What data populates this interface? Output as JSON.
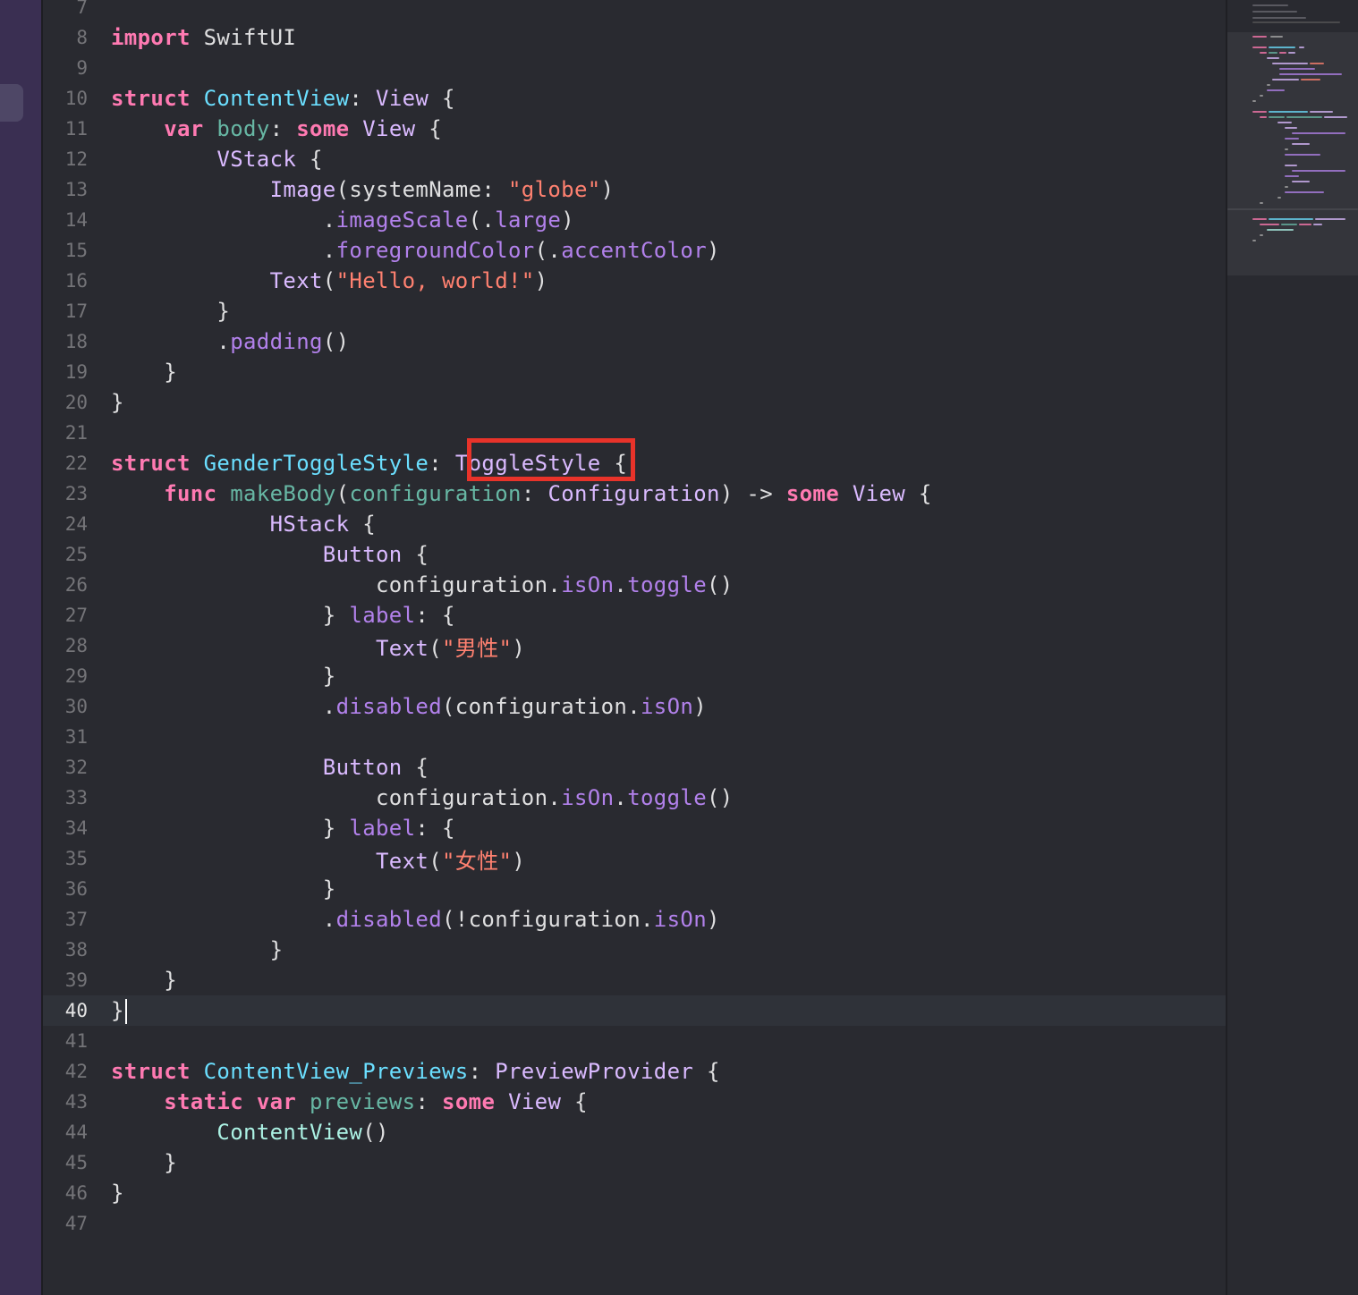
{
  "editor": {
    "language": "Swift",
    "current_line": 40,
    "highlight_color": "#e8332a",
    "highlighted_token": "ToggleStyle",
    "lines": [
      {
        "n": "7",
        "tokens": []
      },
      {
        "n": "8",
        "tokens": [
          [
            "kw",
            "import"
          ],
          [
            "p",
            " SwiftUI"
          ]
        ]
      },
      {
        "n": "9",
        "tokens": []
      },
      {
        "n": "10",
        "tokens": [
          [
            "kw",
            "struct"
          ],
          [
            "p",
            " "
          ],
          [
            "decl",
            "ContentView"
          ],
          [
            "p",
            ": "
          ],
          [
            "typ",
            "View"
          ],
          [
            "p",
            " {"
          ]
        ]
      },
      {
        "n": "11",
        "tokens": [
          [
            "p",
            "    "
          ],
          [
            "kw",
            "var"
          ],
          [
            "p",
            " "
          ],
          [
            "dfn",
            "body"
          ],
          [
            "p",
            ": "
          ],
          [
            "kw",
            "some"
          ],
          [
            "p",
            " "
          ],
          [
            "typ",
            "View"
          ],
          [
            "p",
            " {"
          ]
        ]
      },
      {
        "n": "12",
        "tokens": [
          [
            "p",
            "        "
          ],
          [
            "typ",
            "VStack"
          ],
          [
            "p",
            " {"
          ]
        ]
      },
      {
        "n": "13",
        "tokens": [
          [
            "p",
            "            "
          ],
          [
            "typ",
            "Image"
          ],
          [
            "p",
            "(systemName: "
          ],
          [
            "str",
            "\"globe\""
          ],
          [
            "p",
            ")"
          ]
        ]
      },
      {
        "n": "14",
        "tokens": [
          [
            "p",
            "                ."
          ],
          [
            "prop",
            "imageScale"
          ],
          [
            "p",
            "(."
          ],
          [
            "prop",
            "large"
          ],
          [
            "p",
            ")"
          ]
        ]
      },
      {
        "n": "15",
        "tokens": [
          [
            "p",
            "                ."
          ],
          [
            "prop",
            "foregroundColor"
          ],
          [
            "p",
            "(."
          ],
          [
            "prop",
            "accentColor"
          ],
          [
            "p",
            ")"
          ]
        ]
      },
      {
        "n": "16",
        "tokens": [
          [
            "p",
            "            "
          ],
          [
            "typ",
            "Text"
          ],
          [
            "p",
            "("
          ],
          [
            "str",
            "\"Hello, world!\""
          ],
          [
            "p",
            ")"
          ]
        ]
      },
      {
        "n": "17",
        "tokens": [
          [
            "p",
            "        }"
          ]
        ]
      },
      {
        "n": "18",
        "tokens": [
          [
            "p",
            "        ."
          ],
          [
            "prop",
            "padding"
          ],
          [
            "p",
            "()"
          ]
        ]
      },
      {
        "n": "19",
        "tokens": [
          [
            "p",
            "    }"
          ]
        ]
      },
      {
        "n": "20",
        "tokens": [
          [
            "p",
            "}"
          ]
        ]
      },
      {
        "n": "21",
        "tokens": []
      },
      {
        "n": "22",
        "tokens": [
          [
            "kw",
            "struct"
          ],
          [
            "p",
            " "
          ],
          [
            "decl",
            "GenderToggleStyle"
          ],
          [
            "p",
            ": "
          ],
          [
            "typ",
            "ToggleStyle"
          ],
          [
            "p",
            " {"
          ]
        ]
      },
      {
        "n": "23",
        "tokens": [
          [
            "p",
            "    "
          ],
          [
            "kw",
            "func"
          ],
          [
            "p",
            " "
          ],
          [
            "dfn",
            "makeBody"
          ],
          [
            "p",
            "("
          ],
          [
            "dfn",
            "configuration"
          ],
          [
            "p",
            ": "
          ],
          [
            "typ",
            "Configuration"
          ],
          [
            "p",
            ") -> "
          ],
          [
            "kw",
            "some"
          ],
          [
            "p",
            " "
          ],
          [
            "typ",
            "View"
          ],
          [
            "p",
            " {"
          ]
        ]
      },
      {
        "n": "24",
        "tokens": [
          [
            "p",
            "            "
          ],
          [
            "typ",
            "HStack"
          ],
          [
            "p",
            " {"
          ]
        ]
      },
      {
        "n": "25",
        "tokens": [
          [
            "p",
            "                "
          ],
          [
            "typ",
            "Button"
          ],
          [
            "p",
            " {"
          ]
        ]
      },
      {
        "n": "26",
        "tokens": [
          [
            "p",
            "                    configuration."
          ],
          [
            "prop",
            "isOn"
          ],
          [
            "p",
            "."
          ],
          [
            "prop",
            "toggle"
          ],
          [
            "p",
            "()"
          ]
        ]
      },
      {
        "n": "27",
        "tokens": [
          [
            "p",
            "                } "
          ],
          [
            "prop",
            "label"
          ],
          [
            "p",
            ": {"
          ]
        ]
      },
      {
        "n": "28",
        "tokens": [
          [
            "p",
            "                    "
          ],
          [
            "typ",
            "Text"
          ],
          [
            "p",
            "("
          ],
          [
            "str",
            "\"男性\""
          ],
          [
            "p",
            ")"
          ]
        ]
      },
      {
        "n": "29",
        "tokens": [
          [
            "p",
            "                }"
          ]
        ]
      },
      {
        "n": "30",
        "tokens": [
          [
            "p",
            "                ."
          ],
          [
            "prop",
            "disabled"
          ],
          [
            "p",
            "(configuration."
          ],
          [
            "prop",
            "isOn"
          ],
          [
            "p",
            ")"
          ]
        ]
      },
      {
        "n": "31",
        "tokens": []
      },
      {
        "n": "32",
        "tokens": [
          [
            "p",
            "                "
          ],
          [
            "typ",
            "Button"
          ],
          [
            "p",
            " {"
          ]
        ]
      },
      {
        "n": "33",
        "tokens": [
          [
            "p",
            "                    configuration."
          ],
          [
            "prop",
            "isOn"
          ],
          [
            "p",
            "."
          ],
          [
            "prop",
            "toggle"
          ],
          [
            "p",
            "()"
          ]
        ]
      },
      {
        "n": "34",
        "tokens": [
          [
            "p",
            "                } "
          ],
          [
            "prop",
            "label"
          ],
          [
            "p",
            ": {"
          ]
        ]
      },
      {
        "n": "35",
        "tokens": [
          [
            "p",
            "                    "
          ],
          [
            "typ",
            "Text"
          ],
          [
            "p",
            "("
          ],
          [
            "str",
            "\"女性\""
          ],
          [
            "p",
            ")"
          ]
        ]
      },
      {
        "n": "36",
        "tokens": [
          [
            "p",
            "                }"
          ]
        ]
      },
      {
        "n": "37",
        "tokens": [
          [
            "p",
            "                ."
          ],
          [
            "prop",
            "disabled"
          ],
          [
            "p",
            "(!configuration."
          ],
          [
            "prop",
            "isOn"
          ],
          [
            "p",
            ")"
          ]
        ]
      },
      {
        "n": "38",
        "tokens": [
          [
            "p",
            "            }"
          ]
        ]
      },
      {
        "n": "39",
        "tokens": [
          [
            "p",
            "    }"
          ]
        ]
      },
      {
        "n": "40",
        "tokens": [
          [
            "p",
            "}"
          ]
        ]
      },
      {
        "n": "41",
        "tokens": []
      },
      {
        "n": "42",
        "tokens": [
          [
            "kw",
            "struct"
          ],
          [
            "p",
            " "
          ],
          [
            "decl",
            "ContentView_Previews"
          ],
          [
            "p",
            ": "
          ],
          [
            "typ",
            "PreviewProvider"
          ],
          [
            "p",
            " {"
          ]
        ]
      },
      {
        "n": "43",
        "tokens": [
          [
            "p",
            "    "
          ],
          [
            "kw",
            "static"
          ],
          [
            "p",
            " "
          ],
          [
            "kw",
            "var"
          ],
          [
            "p",
            " "
          ],
          [
            "dfn",
            "previews"
          ],
          [
            "p",
            ": "
          ],
          [
            "kw",
            "some"
          ],
          [
            "p",
            " "
          ],
          [
            "typ",
            "View"
          ],
          [
            "p",
            " {"
          ]
        ]
      },
      {
        "n": "44",
        "tokens": [
          [
            "p",
            "        "
          ],
          [
            "prj",
            "ContentView"
          ],
          [
            "p",
            "()"
          ]
        ]
      },
      {
        "n": "45",
        "tokens": [
          [
            "p",
            "    }"
          ]
        ]
      },
      {
        "n": "46",
        "tokens": [
          [
            "p",
            "}"
          ]
        ]
      },
      {
        "n": "47",
        "tokens": []
      }
    ]
  }
}
